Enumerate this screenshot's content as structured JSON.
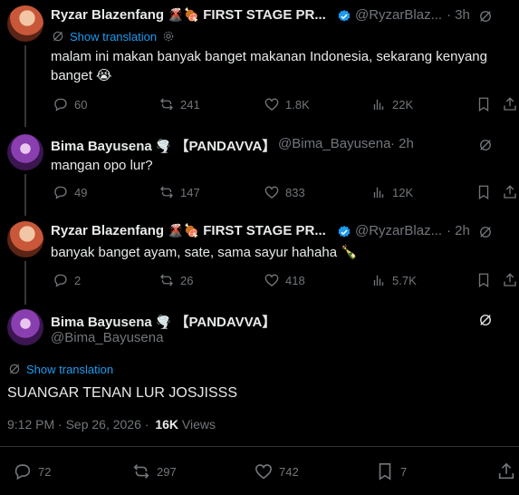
{
  "tweets": [
    {
      "name": "Ryzar Blazenfang",
      "name_suffix": "FIRST STAGE PR...",
      "handle": "@RyzarBlaz...",
      "time": "· 3h",
      "show_translation": "Show translation",
      "text": "malam ini makan banyak banget makanan Indonesia, sekarang kenyang banget 😭",
      "replies": "60",
      "reposts": "241",
      "likes": "1.8K",
      "views": "22K"
    },
    {
      "name": "Bima Bayusena",
      "name_suffix": "【PANDAVVA】",
      "handle": "@Bima_Bayusena",
      "time": "· 2h",
      "text": "mangan opo lur?",
      "replies": "49",
      "reposts": "147",
      "likes": "833",
      "views": "12K"
    },
    {
      "name": "Ryzar Blazenfang",
      "name_suffix": "FIRST STAGE PR...",
      "handle": "@RyzarBlaz...",
      "time": "· 2h",
      "text": "banyak banget ayam, sate, sama sayur hahaha 🍾",
      "replies": "2",
      "reposts": "26",
      "likes": "418",
      "views": "5.7K"
    }
  ],
  "main_tweet": {
    "name": "Bima Bayusena",
    "name_suffix": "【PANDAVVA】",
    "handle": "@Bima_Bayusena",
    "show_translation": "Show translation",
    "text": "SUANGAR TENAN LUR JOSJISSS",
    "time": "9:12 PM · Sep 26, 2026 ·",
    "views_count": "16K",
    "views_label": "Views",
    "replies": "72",
    "reposts": "297",
    "likes": "742",
    "bookmarks": "7"
  },
  "colors": {
    "accent": "#1d9bf0",
    "muted": "#71767b",
    "text": "#e7e9ea",
    "background": "#000000"
  }
}
